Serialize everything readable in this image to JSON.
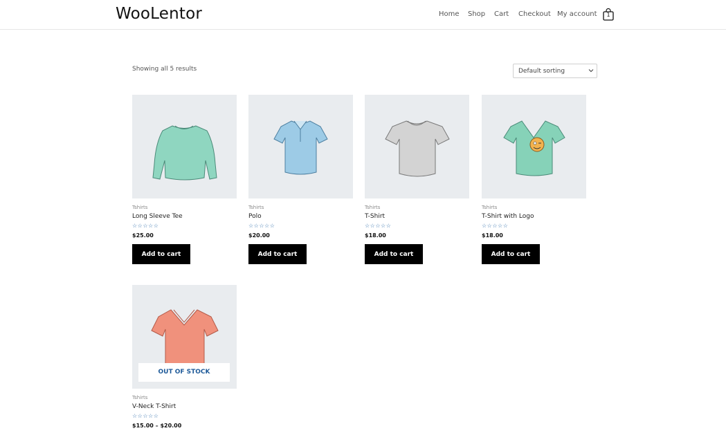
{
  "site": {
    "logo": "WooLentor",
    "nav": [
      "Home",
      "Shop",
      "Cart",
      "Checkout",
      "My account"
    ],
    "cart_count": "1"
  },
  "shop": {
    "results_text": "Showing all 5 results",
    "sort_selected": "Default sorting"
  },
  "products": [
    {
      "category": "Tshirts",
      "name": "Long Sleeve Tee",
      "stars": "☆☆☆☆☆",
      "price": "$25.00",
      "button": "Add to cart",
      "color": "#8fd6c0",
      "icon": "long-sleeve-tee-image"
    },
    {
      "category": "Tshirts",
      "name": "Polo",
      "stars": "☆☆☆☆☆",
      "price": "$20.00",
      "button": "Add to cart",
      "color": "#9dcbe6",
      "icon": "polo-shirt-image"
    },
    {
      "category": "Tshirts",
      "name": "T-Shirt",
      "stars": "☆☆☆☆☆",
      "price": "$18.00",
      "button": "Add to cart",
      "color": "#d3d3d3",
      "icon": "t-shirt-image"
    },
    {
      "category": "Tshirts",
      "name": "T-Shirt with Logo",
      "stars": "☆☆☆☆☆",
      "price": "$18.00",
      "button": "Add to cart",
      "color": "#86d2b8",
      "icon": "t-shirt-with-logo-image"
    },
    {
      "category": "Tshirts",
      "name": "V-Neck T-Shirt",
      "stars": "☆☆☆☆☆",
      "price": "$15.00 – $20.00",
      "badge": "OUT OF STOCK",
      "color": "#f0917c",
      "icon": "v-neck-t-shirt-image"
    }
  ],
  "colors": {
    "accent": "#000000",
    "badge_text": "#1e5a99",
    "stars": "#2a6aa8",
    "image_bg": "#e9ecef"
  }
}
